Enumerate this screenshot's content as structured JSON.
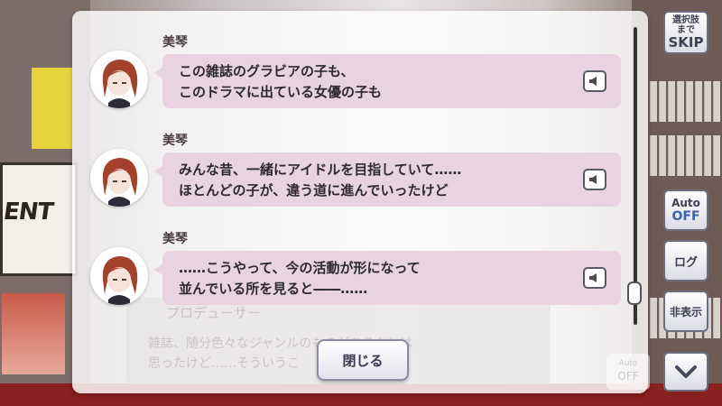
{
  "backlog": {
    "entries": [
      {
        "speaker": "美琴",
        "lines": [
          "この雑誌のグラビアの子も、",
          "このドラマに出ている女優の子も"
        ]
      },
      {
        "speaker": "美琴",
        "lines": [
          "みんな昔、一緒にアイドルを目指していて……",
          "ほとんどの子が、違う道に進んでいったけど"
        ]
      },
      {
        "speaker": "美琴",
        "lines": [
          "……こうやって、今の活動が形になって",
          "並んでいる所を見ると――……"
        ]
      }
    ],
    "close_label": "閉じる"
  },
  "underlying_text": {
    "speaker": "プロデューサー",
    "line1": "雑誌、随分色々なジャンルのものがあるなとは",
    "line2": "思ったけど……そういうこ"
  },
  "controls": {
    "skip_line1": "選択肢",
    "skip_line2": "まで",
    "skip_big": "SKIP",
    "auto_label": "Auto",
    "auto_state": "OFF",
    "log_label": "ログ",
    "hide_label": "非表示",
    "ghost_auto_label": "Auto",
    "ghost_auto_state": "OFF"
  },
  "background": {
    "poster_text": "ENT"
  },
  "icons": {
    "voice": "speaker-icon",
    "next": "chevron-down-icon"
  },
  "colors": {
    "bubble": "#ead3e0",
    "dialog": "#ffffff",
    "auto_off": "#3d5fb0"
  }
}
